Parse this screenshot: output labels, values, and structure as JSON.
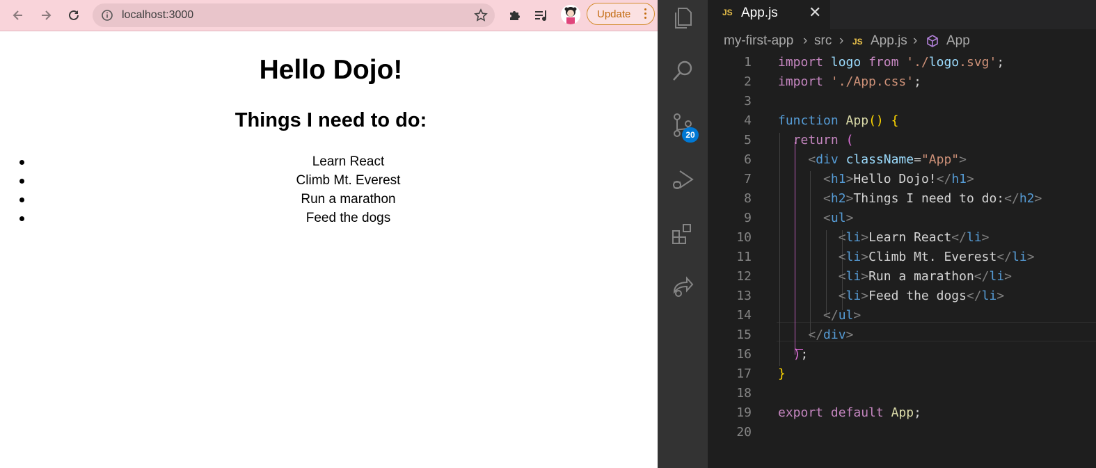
{
  "browser": {
    "url": "localhost:3000",
    "update_label": "Update"
  },
  "page": {
    "title": "Hello Dojo!",
    "subtitle": "Things I need to do:",
    "items": [
      "Learn React",
      "Climb Mt. Everest",
      "Run a marathon",
      "Feed the dogs"
    ]
  },
  "vscode": {
    "scm_badge": "20",
    "tab": {
      "lang_badge": "JS",
      "filename": "App.js"
    },
    "breadcrumb": {
      "project": "my-first-app",
      "folder": "src",
      "file_badge": "JS",
      "file": "App.js",
      "symbol": "App"
    },
    "code_lines": [
      "import logo from './logo.svg';",
      "import './App.css';",
      "",
      "function App() {",
      "  return (",
      "    <div className=\"App\">",
      "      <h1>Hello Dojo!</h1>",
      "      <h2>Things I need to do:</h2>",
      "      <ul>",
      "        <li>Learn React</li>",
      "        <li>Climb Mt. Everest</li>",
      "        <li>Run a marathon</li>",
      "        <li>Feed the dogs</li>",
      "      </ul>",
      "    </div>",
      "  );",
      "}",
      "",
      "export default App;",
      ""
    ],
    "line_numbers": [
      "1",
      "2",
      "3",
      "4",
      "5",
      "6",
      "7",
      "8",
      "9",
      "10",
      "11",
      "12",
      "13",
      "14",
      "15",
      "16",
      "17",
      "18",
      "19",
      "20"
    ]
  },
  "colors": {
    "browser_toolbar": "#f9d4da",
    "editor_bg": "#1e1e1e",
    "activity_bar": "#333333",
    "badge": "#0078d4"
  }
}
